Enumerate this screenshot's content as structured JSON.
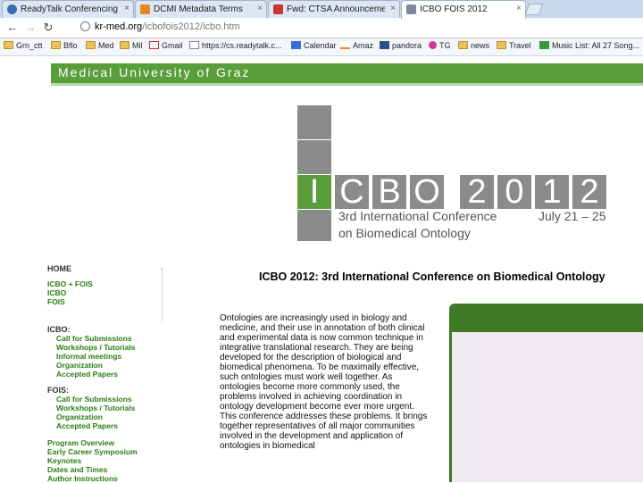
{
  "browser": {
    "tabs": [
      {
        "title": "ReadyTalk Conferencing",
        "favicon_color": "#3a6fb0",
        "active": false
      },
      {
        "title": "DCMI Metadata Terms",
        "favicon_color": "#e08a2a",
        "active": false
      },
      {
        "title": "Fwd: CTSA Announcement",
        "favicon_color": "#cc3333",
        "active": false
      },
      {
        "title": "ICBO FOIS 2012",
        "favicon_color": "#7b8a9a",
        "active": true
      }
    ],
    "tab_close_glyph": "×",
    "url": {
      "host": "kr-med.org",
      "path": "/icbofois2012/icbo.htm"
    },
    "bookmarks": [
      {
        "label": "Grn_ctt",
        "icon": "folder-icon"
      },
      {
        "label": "Bflo",
        "icon": "folder-icon"
      },
      {
        "label": "Med",
        "icon": "folder-icon"
      },
      {
        "label": "Mil",
        "icon": "folder-icon"
      },
      {
        "label": "Gmail",
        "icon": "gmail-icon"
      },
      {
        "label": "https://cs.readytalk.c...",
        "icon": "page-icon"
      },
      {
        "label": "Calendar",
        "icon": "calendar-icon"
      },
      {
        "label": "Amaz",
        "icon": "amazon-icon"
      },
      {
        "label": "pandora",
        "icon": "pandora-icon"
      },
      {
        "label": "TG",
        "icon": "flower-icon"
      },
      {
        "label": "news",
        "icon": "folder-icon"
      },
      {
        "label": "Travel",
        "icon": "folder-icon"
      },
      {
        "label": "Music List: All 27 Song...",
        "icon": "music-icon"
      }
    ]
  },
  "site": {
    "banner": "Medical University of Graz",
    "logo_letters": {
      "icbo": [
        "I",
        "C",
        "B",
        "O"
      ],
      "year": [
        "2",
        "0",
        "1",
        "2"
      ]
    },
    "logo_subtitle_line1": "3rd International Conference",
    "logo_subtitle_line2": "on Biomedical Ontology",
    "logo_dates": "July 21 – 25",
    "colors": {
      "banner_green": "#5a9e3c",
      "logo_gray": "#8b8b8b",
      "link_green": "#2a7d12"
    }
  },
  "sidebar": {
    "home": "HOME",
    "top_links": [
      "ICBO + FOIS",
      "ICBO",
      "FOIS"
    ],
    "icbo_header": "ICBO:",
    "icbo_links": [
      "Call for Submissions",
      "Workshops / Tutorials",
      "Informal meetings",
      "Organization",
      "Accepted Papers"
    ],
    "fois_header": "FOIS:",
    "fois_links": [
      "Call for Submissions",
      "Workshops / Tutorials",
      "Organization",
      "Accepted Papers"
    ],
    "bottom_links": [
      "Program Overview",
      "Early Career Symposium",
      "Keynotes",
      "Dates and Times",
      "Author Instructions"
    ]
  },
  "main": {
    "title": "ICBO 2012: 3rd International Conference on Biomedical Ontology",
    "intro": "Ontologies are increasingly used in biology and medicine, and their use in annotation of both clinical and experimental data is now common technique in integrative translational research. They are being developed for the description of biological and biomedical phenomena. To be maximally effective, such ontologies must work well together. As ontologies become more commonly used, the problems involved in achieving coordination in ontology development become ever more urgent. This conference addresses these problems. It brings together representatives of all major communities involved in the development and application of ontologies in biomedical"
  }
}
